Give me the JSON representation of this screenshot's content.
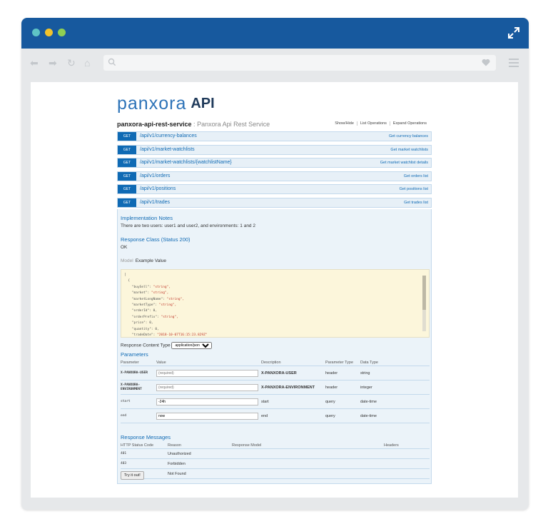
{
  "browser": {
    "window_dots": [
      "#5ec4c5",
      "#f2c32c",
      "#8fcf53"
    ],
    "titlebar_color": "#17599e",
    "icons": [
      "expand-icon",
      "back-arrow-icon",
      "forward-arrow-icon",
      "reload-icon",
      "home-icon",
      "search-icon",
      "heart-icon",
      "menu-icon"
    ]
  },
  "logo": {
    "brand": "panxora",
    "api": "API"
  },
  "service": {
    "name": "panxora-api-rest-service",
    "separator": " : ",
    "description": "Panxora Api Rest Service",
    "links": [
      "Show/Hide",
      "List Operations",
      "Expand Operations"
    ]
  },
  "operations": [
    {
      "verb": "GET",
      "path": "/api/v1/currency-balances",
      "summary": "Get currency balances"
    },
    {
      "verb": "GET",
      "path": "/api/v1/market-watchlists",
      "summary": "Get market watchlists"
    },
    {
      "verb": "GET",
      "path": "/api/v1/market-watchlists/{watchlistName}",
      "summary": "Get market watchlist details"
    },
    {
      "verb": "GET",
      "path": "/api/v1/orders",
      "summary": "Get orders list"
    },
    {
      "verb": "GET",
      "path": "/api/v1/positions",
      "summary": "Get positions list"
    },
    {
      "verb": "GET",
      "path": "/api/v1/trades",
      "summary": "Get trades list"
    }
  ],
  "detail": {
    "impl_title": "Implementation Notes",
    "impl_text": "There are two users: user1 and user2, and environments: 1 and 2",
    "resp_class_title": "Response Class (Status 200)",
    "resp_class_value": "OK",
    "model_label": "Model",
    "example_label": "Example Value",
    "json_lines": [
      {
        "k": "[",
        "v": ""
      },
      {
        "k": "  {",
        "v": ""
      },
      {
        "k": "    \"buySell\": ",
        "v": "\"string\","
      },
      {
        "k": "    \"market\": ",
        "v": "\"string\","
      },
      {
        "k": "    \"marketLongName\": ",
        "v": "\"string\","
      },
      {
        "k": "    \"marketType\": ",
        "v": "\"string\","
      },
      {
        "k": "    \"orderId\": 0,",
        "v": ""
      },
      {
        "k": "    \"orderPrefix\": ",
        "v": "\"string\","
      },
      {
        "k": "    \"price\": 0,",
        "v": ""
      },
      {
        "k": "    \"quantity\": 0,",
        "v": ""
      },
      {
        "k": "    \"tradeDate\": ",
        "v": "\"2018-10-07T16:15:23.829Z\""
      }
    ],
    "content_type_label": "Response Content Type",
    "content_type_value": "application/json",
    "params_title": "Parameters",
    "params_headers": [
      "Parameter",
      "Value",
      "Description",
      "Parameter Type",
      "Data Type"
    ],
    "params": [
      {
        "name": "X-PANXORA-USER",
        "value": "",
        "placeholder": "(required)",
        "description": "X-PANXORA-USER",
        "type": "header",
        "data_type": "string",
        "required": true
      },
      {
        "name": "X-PANXORA-ENVIRONMENT",
        "value": "",
        "placeholder": "(required)",
        "description": "X-PANXORA-ENVIRONMENT",
        "type": "header",
        "data_type": "integer",
        "required": true
      },
      {
        "name": "start",
        "value": "-24h",
        "placeholder": "",
        "description": "start",
        "type": "query",
        "data_type": "date-time",
        "required": false
      },
      {
        "name": "end",
        "value": "now",
        "placeholder": "",
        "description": "end",
        "type": "query",
        "data_type": "date-time",
        "required": false
      }
    ],
    "resp_msgs_title": "Response Messages",
    "resp_headers": [
      "HTTP Status Code",
      "Reason",
      "Response Model",
      "Headers"
    ],
    "responses": [
      {
        "code": "401",
        "reason": "Unauthorized"
      },
      {
        "code": "403",
        "reason": "Forbidden"
      },
      {
        "code": "404",
        "reason": "Not Found"
      }
    ],
    "try_label": "Try it out!"
  }
}
